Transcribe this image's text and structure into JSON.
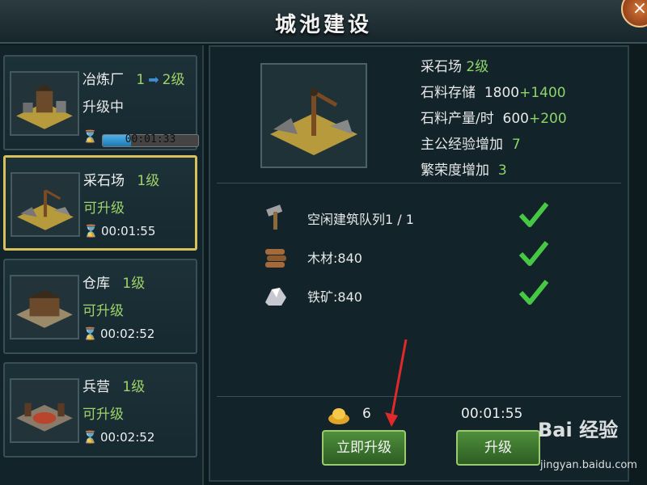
{
  "header": {
    "title": "城池建设",
    "close_label": "×"
  },
  "sidebar": {
    "items": [
      {
        "name": "冶炼厂",
        "level_from": "1",
        "level_to": "2级",
        "status": "升级中",
        "time": "00:01:33",
        "progress": 0.3
      },
      {
        "name": "采石场",
        "level": "1级",
        "status": "可升级",
        "time": "00:01:55"
      },
      {
        "name": "仓库",
        "level": "1级",
        "status": "可升级",
        "time": "00:02:52"
      },
      {
        "name": "兵营",
        "level": "1级",
        "status": "可升级",
        "time": "00:02:52"
      }
    ]
  },
  "detail": {
    "name": "采石场",
    "level": "2级",
    "storage_label": "石料存储",
    "storage_value": "1800",
    "storage_plus": "+1400",
    "output_label": "石料产量/时",
    "output_value": "600",
    "output_plus": "+200",
    "exp_label": "主公经验增加",
    "exp_value": "7",
    "prosperity_label": "繁荣度增加",
    "prosperity_value": "3"
  },
  "requirements": [
    {
      "label": "空闲建筑队列1 / 1",
      "icon": "hammer-icon",
      "met": true
    },
    {
      "label": "木材:840",
      "icon": "wood-icon",
      "met": true
    },
    {
      "label": "铁矿:840",
      "icon": "iron-ore-icon",
      "met": true
    }
  ],
  "footer": {
    "gold_cost": "6",
    "upgrade_time": "00:01:55",
    "instant_upgrade_label": "立即升级",
    "upgrade_label": "升级"
  },
  "watermark": {
    "text": "Bai 经验",
    "url": "jingyan.baidu.com"
  },
  "colors": {
    "accent_green": "#8fd46a",
    "selected_border": "#d8c05a",
    "progress_blue": "#3c8fd4"
  }
}
